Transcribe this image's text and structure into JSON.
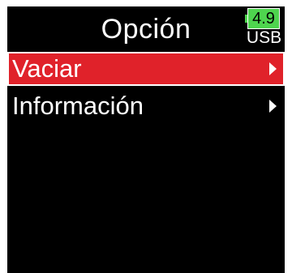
{
  "header": {
    "title": "Opción"
  },
  "battery": {
    "level": "4.9",
    "source": "USB",
    "color": "#4ed44e"
  },
  "menu": {
    "items": [
      {
        "label": "Vaciar",
        "selected": true,
        "icon": "chevron-right-icon"
      },
      {
        "label": "Información",
        "selected": false,
        "icon": "chevron-right-icon"
      }
    ]
  },
  "colors": {
    "background": "#000000",
    "selection": "#e0222a",
    "text": "#ffffff"
  }
}
